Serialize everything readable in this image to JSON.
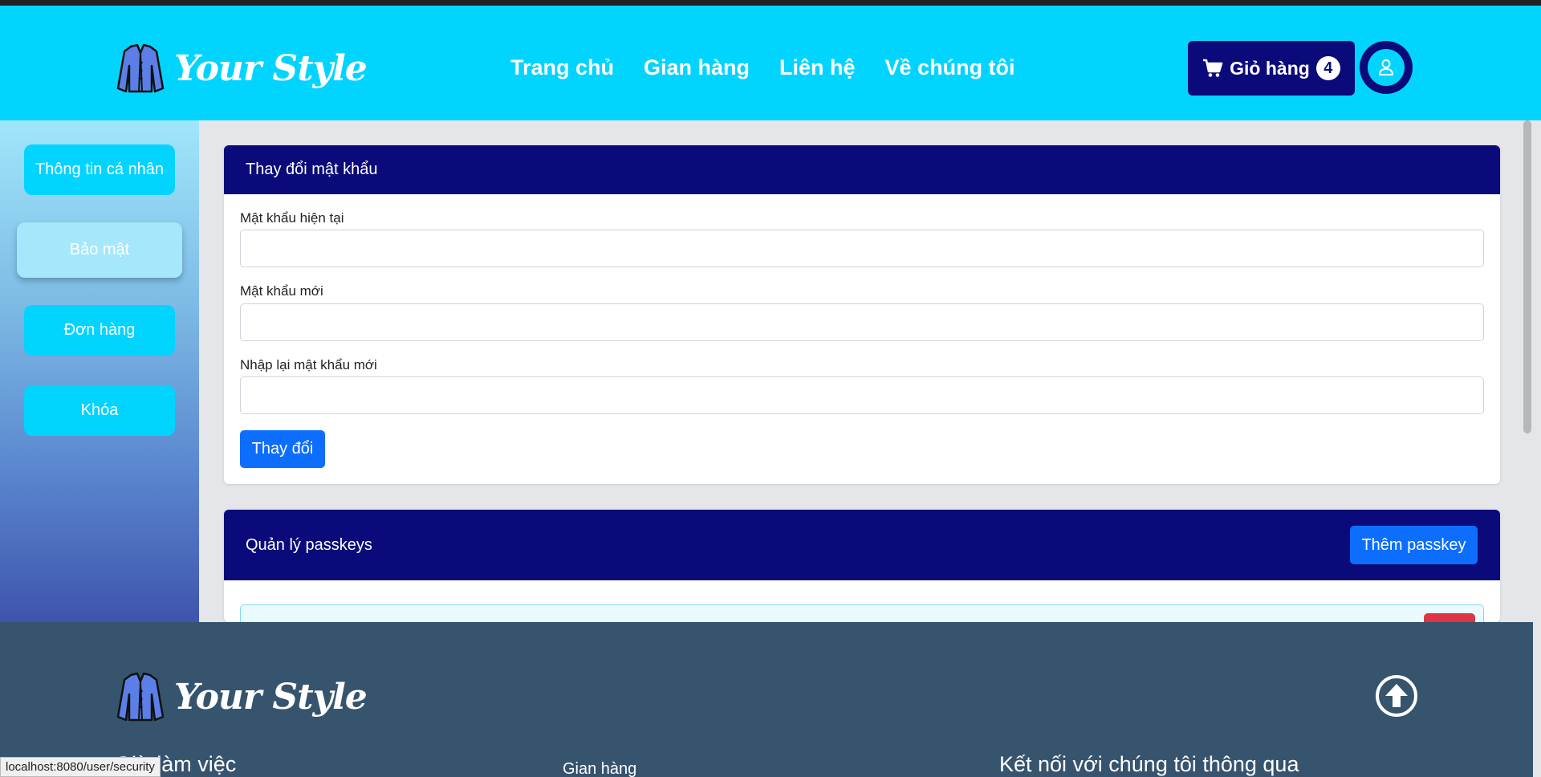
{
  "brand": {
    "name": "Your Style"
  },
  "nav": [
    "Trang chủ",
    "Gian hàng",
    "Liên hệ",
    "Về chúng tôi"
  ],
  "cart": {
    "label": "Giỏ hàng",
    "count": "4"
  },
  "sidebar": {
    "items": [
      {
        "label": "Thông tin cá nhân",
        "active": false
      },
      {
        "label": "Bảo mật",
        "active": true
      },
      {
        "label": "Đơn hàng",
        "active": false
      },
      {
        "label": "Khóa",
        "active": false
      }
    ]
  },
  "password_card": {
    "title": "Thay đổi mật khẩu",
    "current_label": "Mật khẩu hiện tại",
    "new_label": "Mật khẩu mới",
    "confirm_label": "Nhập lại mật khẩu mới",
    "submit_label": "Thay đổi"
  },
  "passkey_card": {
    "title": "Quản lý passkeys",
    "add_label": "Thêm passkey"
  },
  "footer": {
    "col1_heading": "Giờ làm việc",
    "col2_link": "Gian hàng",
    "col3_heading": "Kết nối với chúng tôi thông qua"
  },
  "status_url": "localhost:8080/user/security",
  "colors": {
    "header": "#00d4ff",
    "navy": "#0a0a7a",
    "primary": "#0d6efd",
    "footer": "#36546e",
    "danger": "#dc3545"
  },
  "icons": [
    "jacket-logo-icon",
    "cart-icon",
    "user-icon",
    "arrow-up-circle-icon"
  ]
}
